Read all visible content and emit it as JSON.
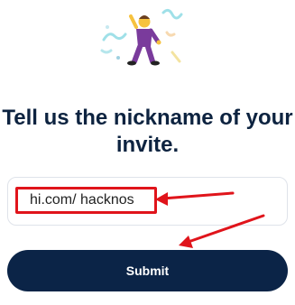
{
  "headline": "Tell us the nickname of your invite.",
  "invite_input": {
    "value": "hi.com/ hacknos"
  },
  "submit_button": {
    "label": "Submit"
  },
  "illustration": {
    "icon": "dancing-man-icon"
  },
  "annotation": {
    "color": "#e0141b",
    "arrow_count": 2
  }
}
